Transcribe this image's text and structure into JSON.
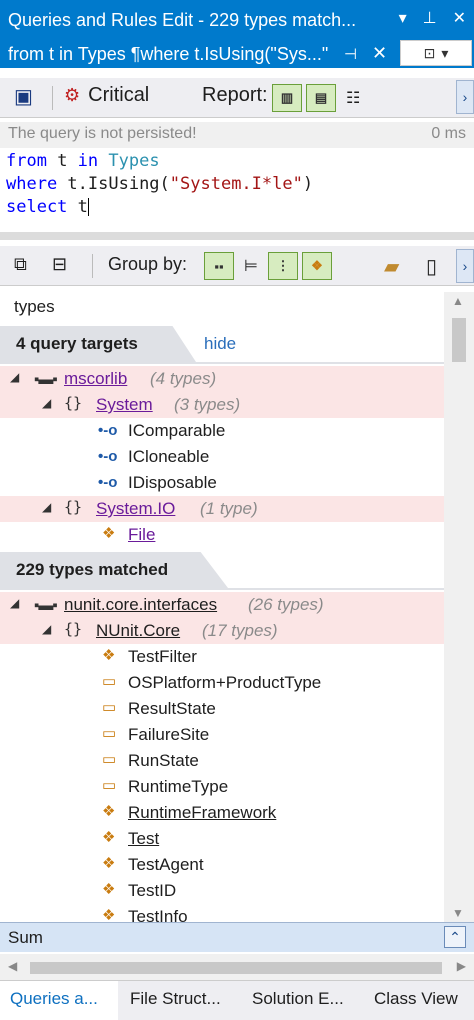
{
  "window": {
    "title": "Queries and Rules Edit  - 229 types match...",
    "subtitle": "from t in Types ¶where t.IsUsing(\"Sys...\""
  },
  "toolbar": {
    "critical_label": "Critical",
    "report_label": "Report:"
  },
  "status": {
    "message": "The query is not persisted!",
    "duration": "0 ms"
  },
  "query": {
    "line1_kw1": "from",
    "line1_var": " t ",
    "line1_kw2": "in",
    "line1_type": "Types",
    "line2_kw": "where",
    "line2_call": " t.IsUsing(",
    "line2_str": "\"System.I*le\"",
    "line2_end": ")",
    "line3_kw": "select",
    "line3_var": " t"
  },
  "group_toolbar": {
    "group_by_label": "Group by:"
  },
  "search": {
    "value": "types"
  },
  "targets": {
    "header": "4 query targets",
    "hide_label": "hide",
    "rows": [
      {
        "name": "mscorlib",
        "count": "(4 types)"
      },
      {
        "name": "System",
        "count": "(3 types)"
      },
      {
        "name": "IComparable"
      },
      {
        "name": "ICloneable"
      },
      {
        "name": "IDisposable"
      },
      {
        "name": "System.IO",
        "count": "(1 type)"
      },
      {
        "name": "File"
      }
    ]
  },
  "matched": {
    "header": "229 types matched",
    "rows": [
      {
        "name": "nunit.core.interfaces",
        "count": "(26 types)"
      },
      {
        "name": "NUnit.Core",
        "count": "(17 types)"
      },
      {
        "name": "TestFilter"
      },
      {
        "name": "OSPlatform+ProductType"
      },
      {
        "name": "ResultState"
      },
      {
        "name": "FailureSite"
      },
      {
        "name": "RunState"
      },
      {
        "name": "RuntimeType"
      },
      {
        "name": "RuntimeFramework"
      },
      {
        "name": "Test"
      },
      {
        "name": "TestAgent"
      },
      {
        "name": "TestID"
      },
      {
        "name": "TestInfo"
      }
    ]
  },
  "footer": {
    "sum_label": "Sum",
    "tabs": [
      "Queries a...",
      "File Struct...",
      "Solution E...",
      "Class View"
    ]
  }
}
